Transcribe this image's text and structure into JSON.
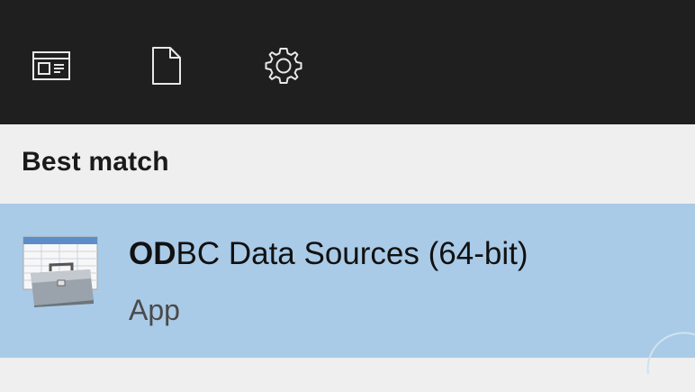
{
  "toolbar": {
    "buttons": [
      {
        "icon": "apps-icon"
      },
      {
        "icon": "document-icon"
      },
      {
        "icon": "settings-gear-icon"
      }
    ],
    "background": "#1f1f1f"
  },
  "section": {
    "title": "Best match"
  },
  "result": {
    "title_match": "OD",
    "title_rest": "BC Data Sources (64-bit)",
    "subtitle": "App",
    "icon": "odbc-datasource-icon",
    "highlight_color": "#a9cbe8"
  }
}
